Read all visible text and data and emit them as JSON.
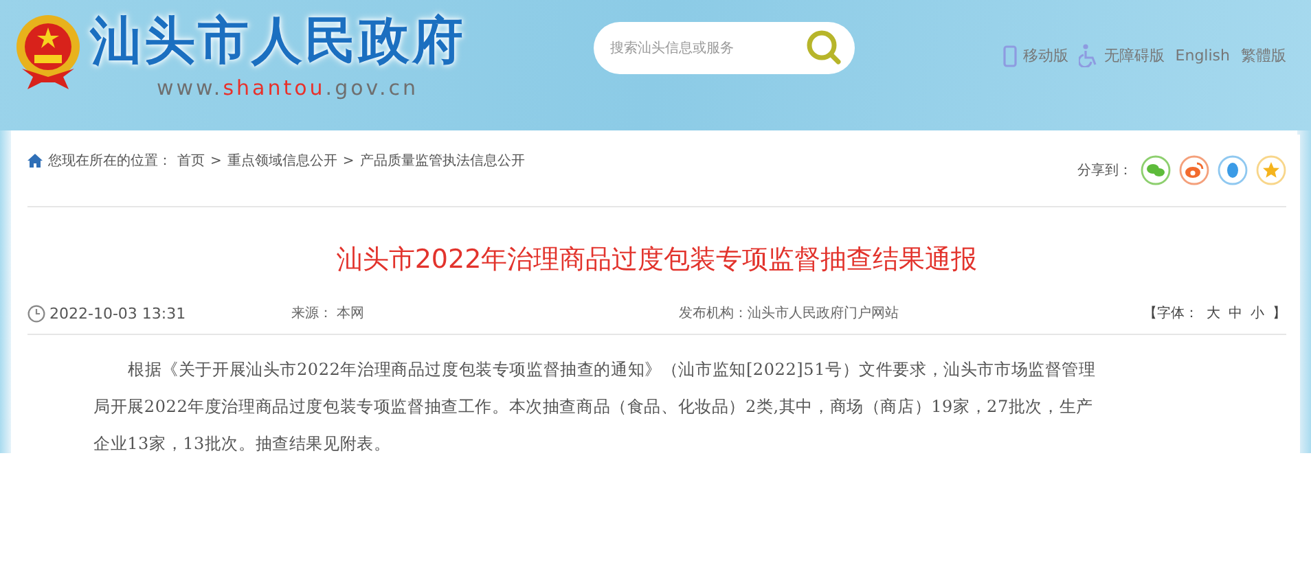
{
  "header": {
    "site_title": "汕头市人民政府",
    "url_parts": [
      {
        "text": "www.",
        "highlight": false
      },
      {
        "text": "shantou",
        "highlight": true
      },
      {
        "text": ".gov.cn",
        "highlight": false
      }
    ],
    "search": {
      "placeholder": "搜索汕头信息或服务"
    },
    "links": [
      {
        "kind": "mobile",
        "label": "移动版"
      },
      {
        "kind": "accessible",
        "label": "无障碍版"
      },
      {
        "kind": "plain",
        "label": "English"
      },
      {
        "kind": "plain",
        "label": "繁體版"
      }
    ]
  },
  "breadcrumb": {
    "prefix": "您现在所在的位置：",
    "items": [
      "首页",
      "重点领域信息公开",
      "产品质量监管执法信息公开"
    ],
    "separator": ">"
  },
  "share": {
    "label": "分享到："
  },
  "article": {
    "title": "汕头市2022年治理商品过度包装专项监督抽查结果通报",
    "date": "2022-10-03 13:31",
    "source": "来源： 本网",
    "publisher": "发布机构：汕头市人民政府门户网站",
    "font_size": {
      "open": "【字体：",
      "options": [
        "大",
        "中",
        "小"
      ],
      "close": "】"
    },
    "paragraph_lines": [
      "根据《关于开展汕头市2022年治理商品过度包装专项监督抽查的通知》（汕市监知[2022]51号）文件要求，汕头市市场监督管理",
      "局开展2022年度治理商品过度包装专项监督抽查工作。本次抽查商品（食品、化妆品）2类,其中，商场（商店）19家，27批次，生产",
      "企业13家，13批次。抽查结果见附表。"
    ]
  }
}
